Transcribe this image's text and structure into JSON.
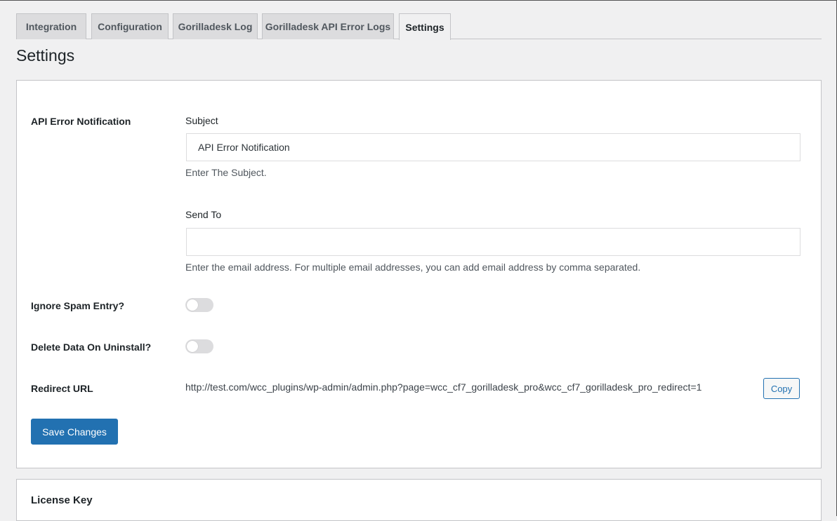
{
  "tabs": [
    {
      "label": "Integration",
      "active": false
    },
    {
      "label": "Configuration",
      "active": false
    },
    {
      "label": "Gorilladesk Log",
      "active": false
    },
    {
      "label": "Gorilladesk API Error Logs",
      "active": false
    },
    {
      "label": "Settings",
      "active": true
    }
  ],
  "page_title": "Settings",
  "api_error": {
    "label": "API Error Notification",
    "subject_label": "Subject",
    "subject_value": "API Error Notification",
    "subject_help": "Enter The Subject.",
    "send_to_label": "Send To",
    "send_to_value": "",
    "send_to_help": "Enter the email address. For multiple email addresses, you can add email address by comma separated."
  },
  "ignore_spam": {
    "label": "Ignore Spam Entry?",
    "enabled": false
  },
  "delete_data": {
    "label": "Delete Data On Uninstall?",
    "enabled": false
  },
  "redirect": {
    "label": "Redirect URL",
    "url": "http://test.com/wcc_plugins/wp-admin/admin.php?page=wcc_cf7_gorilladesk_pro&wcc_cf7_gorilladesk_pro_redirect=1",
    "copy_label": "Copy"
  },
  "save_label": "Save Changes",
  "license_title": "License Key",
  "colors": {
    "primary": "#2271b1",
    "background": "#f0f0f1",
    "toggle_off": "#dcdcde"
  }
}
